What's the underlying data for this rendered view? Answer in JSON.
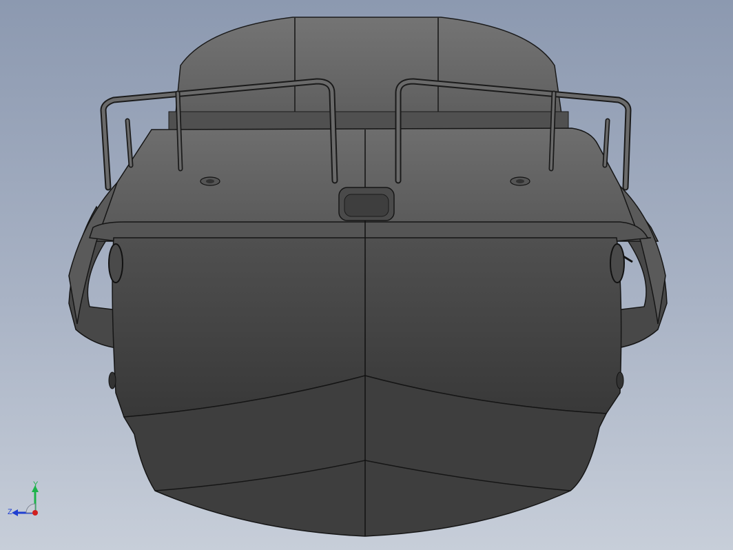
{
  "viewport": {
    "background_top": "#8c99b0",
    "background_bottom": "#c7ced9",
    "model_shade_dark": "#3a3a3a",
    "model_shade_mid": "#4f4f4f",
    "model_shade_light": "#6c6c6c",
    "edge_color": "#101010"
  },
  "triad": {
    "y_label": "Y",
    "z_label": "Z",
    "y_color": "#1db34a",
    "z_color": "#1f3fd1",
    "x_color": "#d11f1f",
    "icon": "coordinate-triad-icon"
  }
}
